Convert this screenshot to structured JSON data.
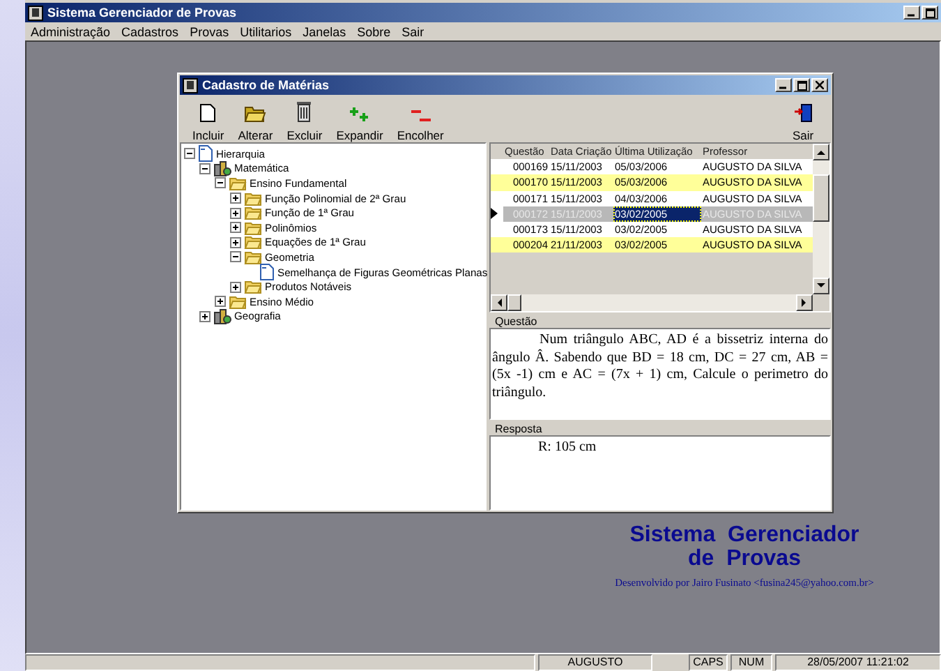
{
  "app_window": {
    "title": "Sistema Gerenciador de Provas"
  },
  "menu": [
    "Administração",
    "Cadastros",
    "Provas",
    "Utilitarios",
    "Janelas",
    "Sobre",
    "Sair"
  ],
  "child_window": {
    "title": "Cadastro de Matérias",
    "toolbar": [
      {
        "label": "Incluir",
        "kind": "new"
      },
      {
        "label": "Alterar",
        "kind": "open"
      },
      {
        "label": "Excluir",
        "kind": "delete"
      },
      {
        "label": "Expandir",
        "kind": "expand"
      },
      {
        "label": "Encolher",
        "kind": "collapse"
      }
    ],
    "exit_button": {
      "label": "Sair"
    },
    "tree": [
      {
        "label": "Hierarquia",
        "kind": "root",
        "expanded": true,
        "children": [
          {
            "label": "Matemática",
            "kind": "subject",
            "expanded": true,
            "children": [
              {
                "label": "Ensino Fundamental",
                "kind": "folder",
                "expanded": true,
                "children": [
                  {
                    "label": "Função Polinomial de 2ª Grau",
                    "kind": "folder",
                    "expanded": false
                  },
                  {
                    "label": "Função de 1ª Grau",
                    "kind": "folder",
                    "expanded": false
                  },
                  {
                    "label": "Polinômios",
                    "kind": "folder",
                    "expanded": false
                  },
                  {
                    "label": "Equações de 1ª Grau",
                    "kind": "folder",
                    "expanded": false
                  },
                  {
                    "label": "Geometria",
                    "kind": "folder",
                    "expanded": true,
                    "children": [
                      {
                        "label": "Semelhança de Figuras Geométricas Planas",
                        "kind": "doc"
                      }
                    ]
                  },
                  {
                    "label": "Produtos Notáveis",
                    "kind": "folder",
                    "expanded": false
                  }
                ]
              },
              {
                "label": "Ensino Médio",
                "kind": "folder",
                "expanded": false
              }
            ]
          },
          {
            "label": "Geografia",
            "kind": "subject",
            "expanded": false
          }
        ]
      }
    ],
    "grid": {
      "columns": [
        "Questão",
        "Data Criação",
        "Última Utilização",
        "Professor"
      ],
      "rows": [
        {
          "selected": false,
          "color": "#ffffff",
          "cells": [
            {
              "text": "000169",
              "focused": false
            },
            {
              "text": "15/11/2003",
              "focused": false
            },
            {
              "text": "05/03/2006",
              "focused": false
            },
            {
              "text": "AUGUSTO DA SILVA",
              "focused": false
            }
          ]
        },
        {
          "selected": false,
          "color": "#ffff99",
          "cells": [
            {
              "text": "000170",
              "focused": false
            },
            {
              "text": "15/11/2003",
              "focused": false
            },
            {
              "text": "05/03/2006",
              "focused": false
            },
            {
              "text": "AUGUSTO DA SILVA",
              "focused": false
            }
          ]
        },
        {
          "selected": false,
          "color": "#ffffff",
          "cells": [
            {
              "text": "000171",
              "focused": false
            },
            {
              "text": "15/11/2003",
              "focused": false
            },
            {
              "text": "04/03/2006",
              "focused": false
            },
            {
              "text": "AUGUSTO DA SILVA",
              "focused": false
            }
          ]
        },
        {
          "selected": true,
          "color": "#ffffff",
          "cells": [
            {
              "text": "000172",
              "focused": false
            },
            {
              "text": "15/11/2003",
              "focused": false
            },
            {
              "text": "03/02/2005",
              "focused": true
            },
            {
              "text": "AUGUSTO DA SILVA",
              "focused": false
            }
          ]
        },
        {
          "selected": false,
          "color": "#ffffff",
          "cells": [
            {
              "text": "000173",
              "focused": false
            },
            {
              "text": "15/11/2003",
              "focused": false
            },
            {
              "text": "03/02/2005",
              "focused": false
            },
            {
              "text": "AUGUSTO DA SILVA",
              "focused": false
            }
          ]
        },
        {
          "selected": false,
          "color": "#ffff99",
          "cells": [
            {
              "text": "000204",
              "focused": false
            },
            {
              "text": "21/11/2003",
              "focused": false
            },
            {
              "text": "03/02/2005",
              "focused": false
            },
            {
              "text": "AUGUSTO DA SILVA",
              "focused": false
            }
          ]
        }
      ]
    },
    "question": {
      "label": "Questão",
      "text": "Num triângulo ABC, AD é a bissetriz interna do ângulo Â. Sabendo que BD = 18 cm, DC = 27 cm, AB = (5x -1) cm e AC = (7x + 1) cm, Calcule o perimetro do triângulo."
    },
    "answer": {
      "label": "Resposta",
      "text": "R: 105 cm"
    }
  },
  "branding": {
    "title_line_1": "Sistema  Gerenciador",
    "title_line_2": "de  Provas",
    "credit": "Desenvolvido por Jairo Fusinato <fusina245@yahoo.com.br>"
  },
  "status_bar": {
    "user": "AUGUSTO",
    "caps": "CAPS",
    "num": "NUM",
    "datetime": "28/05/2007 11:21:02"
  }
}
